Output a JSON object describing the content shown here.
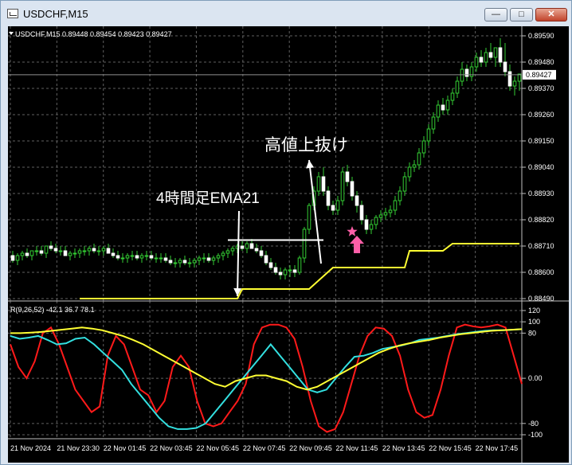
{
  "window": {
    "title": "USDCHF,M15",
    "minimize_label": "—",
    "maximize_label": "□",
    "close_label": "✕"
  },
  "chart_data": [
    {
      "type": "candlestick",
      "header": "USDCHF,M15  0.89448 0.89454 0.89423 0.89427",
      "current_price": "0.89427",
      "ylim": [
        0.8849,
        0.8959
      ],
      "yticks": [
        "0.89590",
        "0.89480",
        "0.89370",
        "0.89260",
        "0.89150",
        "0.89040",
        "0.88930",
        "0.88820",
        "0.88710",
        "0.88600",
        "0.88490"
      ],
      "xticks": [
        "21 Nov 2024",
        "21 Nov 23:30",
        "22 Nov 01:45",
        "22 Nov 03:45",
        "22 Nov 05:45",
        "22 Nov 07:45",
        "22 Nov 09:45",
        "22 Nov 11:45",
        "22 Nov 13:45",
        "22 Nov 15:45",
        "22 Nov 17:45"
      ],
      "grid": true,
      "candles": {
        "open": [
          0.8867,
          0.8865,
          0.8867,
          0.8868,
          0.8867,
          0.8869,
          0.8869,
          0.8868,
          0.8871,
          0.887,
          0.8869,
          0.8869,
          0.8867,
          0.8868,
          0.8868,
          0.8869,
          0.8869,
          0.887,
          0.8869,
          0.8869,
          0.887,
          0.8868,
          0.8867,
          0.8866,
          0.8866,
          0.8867,
          0.8867,
          0.8866,
          0.8867,
          0.8867,
          0.8866,
          0.8866,
          0.8866,
          0.8865,
          0.8864,
          0.8864,
          0.8865,
          0.8864,
          0.8864,
          0.8865,
          0.8866,
          0.8866,
          0.8865,
          0.8866,
          0.8867,
          0.8868,
          0.8869,
          0.887,
          0.8871,
          0.887,
          0.8872,
          0.887,
          0.8869,
          0.8867,
          0.8864,
          0.8862,
          0.886,
          0.8859,
          0.8861,
          0.8861,
          0.886,
          0.8866,
          0.8878,
          0.8888,
          0.8894,
          0.89,
          0.8894,
          0.8888,
          0.8886,
          0.889,
          0.8902,
          0.8898,
          0.8892,
          0.8888,
          0.8882,
          0.8878,
          0.888,
          0.8883,
          0.8884,
          0.8885,
          0.8886,
          0.889,
          0.8894,
          0.89,
          0.8904,
          0.8905,
          0.891,
          0.8915,
          0.892,
          0.8925,
          0.893,
          0.8928,
          0.8932,
          0.8935,
          0.894,
          0.8945,
          0.8942,
          0.8946,
          0.895,
          0.8948,
          0.8952,
          0.895,
          0.8954,
          0.8948,
          0.8944,
          0.8938,
          0.894
        ],
        "high": [
          0.8869,
          0.8868,
          0.8869,
          0.887,
          0.8869,
          0.8871,
          0.8871,
          0.8871,
          0.8873,
          0.8872,
          0.8871,
          0.8871,
          0.8869,
          0.887,
          0.887,
          0.8871,
          0.8871,
          0.8872,
          0.8871,
          0.8871,
          0.8872,
          0.887,
          0.8869,
          0.8868,
          0.8868,
          0.8869,
          0.8869,
          0.8868,
          0.8869,
          0.8869,
          0.8868,
          0.8868,
          0.8868,
          0.8867,
          0.8866,
          0.8866,
          0.8867,
          0.8866,
          0.8866,
          0.8867,
          0.8868,
          0.8868,
          0.8867,
          0.8868,
          0.8869,
          0.887,
          0.8871,
          0.8872,
          0.8873,
          0.8873,
          0.8874,
          0.8872,
          0.8871,
          0.8869,
          0.8866,
          0.8864,
          0.8862,
          0.8862,
          0.8863,
          0.8863,
          0.8867,
          0.8879,
          0.8889,
          0.8896,
          0.8902,
          0.8904,
          0.8896,
          0.889,
          0.8892,
          0.8904,
          0.8905,
          0.89,
          0.8894,
          0.889,
          0.8884,
          0.8882,
          0.8884,
          0.8886,
          0.8887,
          0.8888,
          0.8892,
          0.8896,
          0.8902,
          0.8906,
          0.8907,
          0.8912,
          0.8917,
          0.8922,
          0.8927,
          0.8932,
          0.8933,
          0.8934,
          0.8937,
          0.8942,
          0.8948,
          0.8947,
          0.8948,
          0.8952,
          0.8953,
          0.8954,
          0.8956,
          0.8954,
          0.8958,
          0.8956,
          0.8947,
          0.8942,
          0.8942
        ],
        "low": [
          0.8864,
          0.8863,
          0.8865,
          0.8866,
          0.8865,
          0.8867,
          0.8867,
          0.8866,
          0.8869,
          0.8868,
          0.8867,
          0.8867,
          0.8865,
          0.8866,
          0.8866,
          0.8867,
          0.8867,
          0.8868,
          0.8867,
          0.8867,
          0.8868,
          0.8866,
          0.8865,
          0.8864,
          0.8864,
          0.8865,
          0.8865,
          0.8864,
          0.8865,
          0.8865,
          0.8864,
          0.8864,
          0.8864,
          0.8863,
          0.8862,
          0.8862,
          0.8863,
          0.8862,
          0.8862,
          0.8863,
          0.8864,
          0.8864,
          0.8863,
          0.8864,
          0.8865,
          0.8866,
          0.8867,
          0.8868,
          0.8869,
          0.8868,
          0.887,
          0.8868,
          0.8866,
          0.8863,
          0.8861,
          0.8859,
          0.8857,
          0.8857,
          0.8858,
          0.8858,
          0.8859,
          0.8864,
          0.8876,
          0.8886,
          0.8892,
          0.8892,
          0.8886,
          0.8884,
          0.8884,
          0.8888,
          0.8896,
          0.889,
          0.8885,
          0.888,
          0.8876,
          0.8876,
          0.8878,
          0.8881,
          0.8882,
          0.8883,
          0.8884,
          0.8888,
          0.8892,
          0.8898,
          0.8902,
          0.8903,
          0.8908,
          0.8913,
          0.8918,
          0.8923,
          0.8926,
          0.8926,
          0.893,
          0.8933,
          0.8938,
          0.894,
          0.894,
          0.8944,
          0.8946,
          0.8946,
          0.8949,
          0.8946,
          0.8946,
          0.8942,
          0.8936,
          0.8934,
          0.8936
        ],
        "close": [
          0.8865,
          0.8867,
          0.8868,
          0.8867,
          0.8869,
          0.8869,
          0.8868,
          0.8871,
          0.887,
          0.8869,
          0.8869,
          0.8867,
          0.8868,
          0.8868,
          0.8869,
          0.8869,
          0.887,
          0.8869,
          0.8869,
          0.887,
          0.8868,
          0.8867,
          0.8866,
          0.8866,
          0.8867,
          0.8867,
          0.8866,
          0.8867,
          0.8867,
          0.8866,
          0.8866,
          0.8866,
          0.8865,
          0.8864,
          0.8864,
          0.8865,
          0.8864,
          0.8864,
          0.8865,
          0.8866,
          0.8866,
          0.8865,
          0.8866,
          0.8867,
          0.8868,
          0.8869,
          0.887,
          0.8871,
          0.887,
          0.8872,
          0.887,
          0.8869,
          0.8867,
          0.8864,
          0.8862,
          0.886,
          0.8859,
          0.8861,
          0.8861,
          0.886,
          0.8866,
          0.8878,
          0.8888,
          0.8894,
          0.89,
          0.8894,
          0.8888,
          0.8886,
          0.889,
          0.8902,
          0.8898,
          0.8892,
          0.8888,
          0.8882,
          0.8878,
          0.888,
          0.8883,
          0.8884,
          0.8885,
          0.8886,
          0.889,
          0.8894,
          0.89,
          0.8904,
          0.8905,
          0.891,
          0.8915,
          0.892,
          0.8925,
          0.893,
          0.8928,
          0.8932,
          0.8935,
          0.894,
          0.8945,
          0.8942,
          0.8946,
          0.895,
          0.8948,
          0.8952,
          0.895,
          0.8954,
          0.8948,
          0.8944,
          0.8938,
          0.894,
          0.8943
        ]
      },
      "ema21_4h": [
        [
          14,
          0.8849
        ],
        [
          47,
          0.8849
        ],
        [
          48,
          0.8853
        ],
        [
          62,
          0.8853
        ],
        [
          67,
          0.8862
        ],
        [
          82,
          0.8862
        ],
        [
          83,
          0.8869
        ],
        [
          90,
          0.8869
        ],
        [
          92,
          0.8872
        ],
        [
          106,
          0.8872
        ]
      ],
      "horizontal_line": {
        "price": 0.88735,
        "from": 45,
        "to": 65
      },
      "annotations": [
        {
          "text": "4時間足EMA21",
          "arrow_to": [
            47,
            0.885
          ]
        },
        {
          "text": "高値上抜け",
          "arrow_to": [
            62,
            0.8907
          ]
        }
      ],
      "markers": [
        {
          "type": "star",
          "index": 71,
          "price": 0.8877
        },
        {
          "type": "arrow-up",
          "index": 72,
          "price": 0.8872
        }
      ]
    },
    {
      "type": "line",
      "header": "R(9,26,52) -42.1 36.7 78.1",
      "ylim": [
        -100,
        120
      ],
      "yticks": [
        "120",
        "100",
        "80",
        "0.00",
        "-80",
        "-100"
      ],
      "series": [
        {
          "color": "#ff1a1a",
          "values": [
            60,
            20,
            0,
            30,
            80,
            90,
            60,
            20,
            -20,
            -40,
            -60,
            -50,
            40,
            75,
            60,
            20,
            -20,
            -30,
            -60,
            -40,
            20,
            40,
            20,
            -40,
            -80,
            -85,
            -80,
            -60,
            -40,
            -10,
            60,
            90,
            95,
            95,
            90,
            70,
            20,
            -40,
            -85,
            -95,
            -90,
            -60,
            -10,
            40,
            75,
            90,
            88,
            75,
            40,
            -20,
            -60,
            -70,
            -65,
            -20,
            40,
            90,
            95,
            92,
            90,
            92,
            95,
            90,
            40,
            -10
          ]
        },
        {
          "color": "#33e0e0",
          "values": [
            75,
            70,
            72,
            75,
            68,
            60,
            62,
            70,
            72,
            60,
            45,
            30,
            15,
            -10,
            -30,
            -50,
            -70,
            -85,
            -90,
            -90,
            -88,
            -80,
            -60,
            -40,
            -20,
            0,
            20,
            40,
            60,
            40,
            20,
            0,
            -20,
            -25,
            -20,
            0,
            20,
            38,
            40,
            45,
            52,
            55,
            58,
            62,
            68,
            70,
            72,
            75,
            78,
            80,
            82,
            84,
            85,
            85,
            86,
            87
          ]
        },
        {
          "color": "#ffff33",
          "values": [
            80,
            80,
            81,
            82,
            84,
            86,
            88,
            90,
            88,
            85,
            80,
            75,
            68,
            60,
            50,
            40,
            30,
            20,
            10,
            0,
            -10,
            -15,
            -5,
            0,
            5,
            5,
            0,
            -5,
            -15,
            -20,
            -15,
            -5,
            5,
            15,
            25,
            35,
            45,
            52,
            58,
            62,
            65,
            68,
            72,
            75,
            78,
            80,
            82,
            84,
            85,
            86,
            87
          ]
        }
      ]
    }
  ]
}
